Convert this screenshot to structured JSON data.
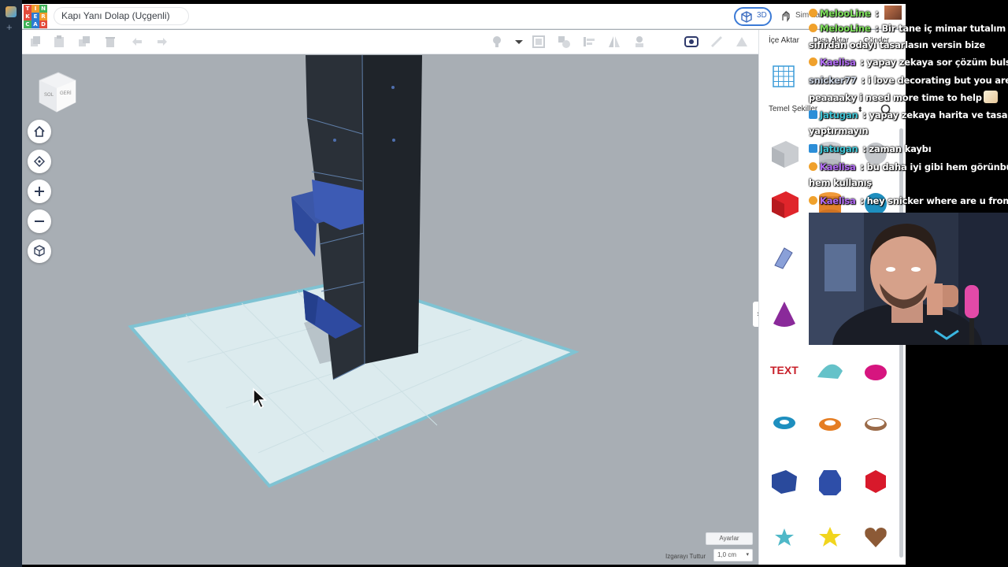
{
  "colors": {
    "accent": "#3b7ad6",
    "workplane": "#dcebee",
    "workplane_edge": "#7fc3d3",
    "box_dark": "#22272d",
    "box_blue": "#2e4a9c",
    "chat_name_green": "#7ee15c",
    "chat_name_purple": "#b36cf5",
    "chat_name_teal": "#3fc5d6",
    "chat_name_blue": "#4ab3f0"
  },
  "app": {
    "logo_letters": [
      "T",
      "I",
      "N",
      "K",
      "E",
      "R",
      "C",
      "A",
      "D"
    ],
    "logo_colors": [
      "#e24a3b",
      "#f19b2c",
      "#3fb257",
      "#e24a3b",
      "#2d7bd3",
      "#f19b2c",
      "#3fb257",
      "#2d7bd3",
      "#e24a3b"
    ],
    "title": "Kapı Yanı Dolap (Uçgenli)",
    "view_3d_label": "3D",
    "sim_label": "Sim Lab"
  },
  "toolbar": {
    "icons": [
      "copy-icon",
      "paste-icon",
      "duplicate-icon",
      "delete-icon",
      "undo-icon",
      "redo-icon",
      "bulb-icon",
      "dropdown-icon",
      "group-icon",
      "ungroup-icon",
      "align-icon",
      "mirror-icon",
      "flip-icon",
      "cruise-icon",
      "ruler-icon",
      "notes-icon",
      "workplane-icon"
    ]
  },
  "right_panel": {
    "tabs": [
      "İçe Aktar",
      "Dışa Aktar",
      "Gönder"
    ],
    "category_select": "Temel Şekiller",
    "shapes": [
      "box",
      "box-red",
      "scribble",
      "cone",
      "text",
      "half-cylinder",
      "paraboloid",
      "torus",
      "tube",
      "ring",
      "wedge",
      "hexagonal-prism",
      "icosahedron",
      "star-teal",
      "star-yellow",
      "heart"
    ]
  },
  "viewport": {
    "viewcube_labels": [
      "SOL",
      "GERİ"
    ],
    "settings_label": "Ayarlar",
    "snap_label": "Izgarayı Tuttur",
    "snap_value": "1,0 cm"
  },
  "chat": {
    "messages": [
      {
        "name": "MelooLine",
        "name_color": "#7ee15c",
        "badge": "sub",
        "text": " :",
        "avatar": true
      },
      {
        "name": "MelooLine",
        "name_color": "#7ee15c",
        "badge": "sub",
        "text": " : Bir tane iç mimar tutalım"
      },
      {
        "name": "",
        "name_color": "",
        "badge": "",
        "text": "sıfırdan odayı tasarlasın versin bize"
      },
      {
        "name": "Kaelisa",
        "name_color": "#b36cf5",
        "badge": "sub",
        "text": " : yapay zekaya sor çözüm bulsun"
      },
      {
        "name": "snicker77",
        "name_color": "#cfd8e6",
        "badge": "",
        "text": " : i love decorating but you are so"
      },
      {
        "name": "",
        "name_color": "",
        "badge": "",
        "text": "peaaaaky i need more time to help",
        "emote": true
      },
      {
        "name": "Jatugan",
        "name_color": "#3fc5d6",
        "badge": "mod",
        "text": " : yapay zekaya harita ve tasarım"
      },
      {
        "name": "",
        "name_color": "",
        "badge": "",
        "text": "yaptırmayın"
      },
      {
        "name": "Jatugan",
        "name_color": "#3fc5d6",
        "badge": "mod",
        "text": " : zaman kaybı"
      },
      {
        "name": "Kaelisa",
        "name_color": "#b36cf5",
        "badge": "sub",
        "text": " : bu daha iyi gibi hem görünbüş"
      },
      {
        "name": "",
        "name_color": "",
        "badge": "",
        "text": "hem kullanış"
      },
      {
        "name": "Kaelisa",
        "name_color": "#b36cf5",
        "badge": "sub",
        "text": " : hey snicker where are u from"
      }
    ]
  }
}
